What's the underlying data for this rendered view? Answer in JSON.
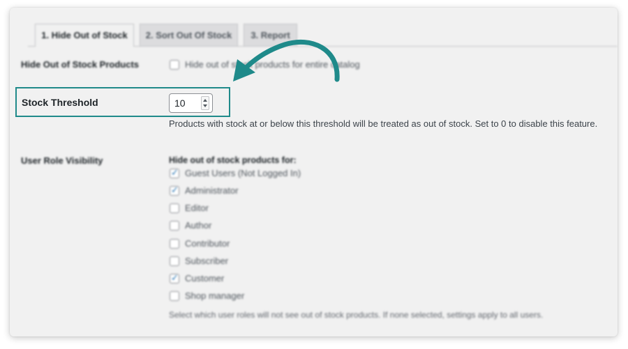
{
  "tabs": [
    {
      "label": "1. Hide Out of Stock"
    },
    {
      "label": "2. Sort Out Of Stock"
    },
    {
      "label": "3. Report"
    }
  ],
  "hide_section": {
    "label": "Hide Out of Stock Products",
    "checkbox_text": "Hide out of stock products for entire catalog",
    "checked": false
  },
  "threshold": {
    "label": "Stock Threshold",
    "value": "10",
    "description": "Products with stock at or below this threshold will be treated as out of stock. Set to 0 to disable this feature."
  },
  "roles": {
    "label": "User Role Visibility",
    "heading": "Hide out of stock products for:",
    "items": [
      {
        "label": "Guest Users (Not Logged In)",
        "checked": true
      },
      {
        "label": "Administrator",
        "checked": true
      },
      {
        "label": "Editor",
        "checked": false
      },
      {
        "label": "Author",
        "checked": false
      },
      {
        "label": "Contributor",
        "checked": false
      },
      {
        "label": "Subscriber",
        "checked": false
      },
      {
        "label": "Customer",
        "checked": true
      },
      {
        "label": "Shop manager",
        "checked": false
      }
    ],
    "help": "Select which user roles will not see out of stock products. If none selected, settings apply to all users."
  },
  "colors": {
    "highlight": "#1f8a8a",
    "checkmark": "#2271b1"
  },
  "icons": {
    "annotation_arrow": "curved-arrow-icon",
    "spinner": "number-spinner-icon"
  }
}
